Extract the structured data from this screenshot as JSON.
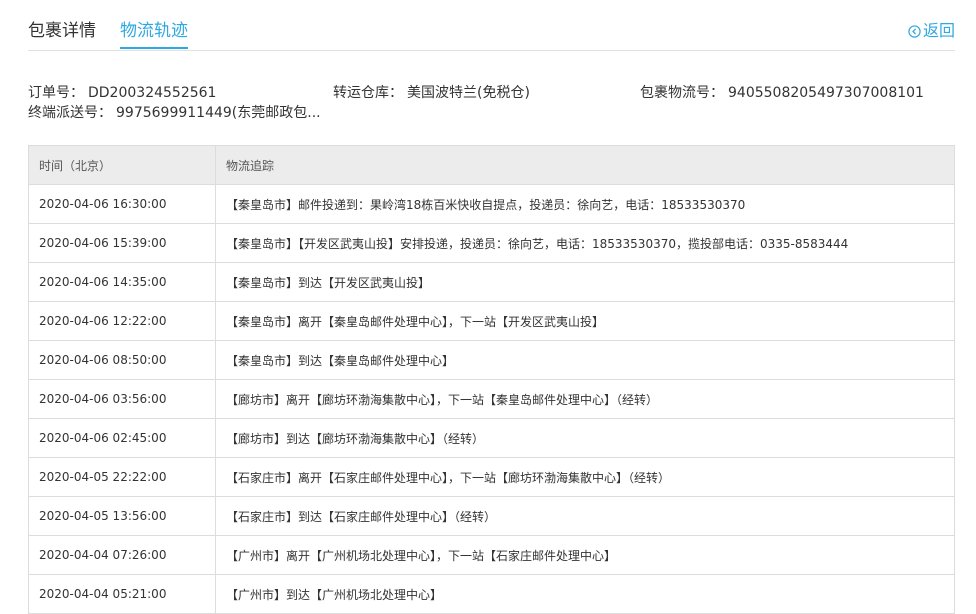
{
  "tabs": {
    "detail": "包裹详情",
    "track": "物流轨迹"
  },
  "back_label": "返回",
  "info": {
    "order_label": "订单号：",
    "order_value": "DD200324552561",
    "warehouse_label": "转运仓库：",
    "warehouse_value": "美国波特兰(免税仓)",
    "tracking_label": "包裹物流号：",
    "tracking_value": "9405508205497307008101",
    "last_mile_label": "终端派送号：",
    "last_mile_value": "9975699911449(东莞邮政包..."
  },
  "table": {
    "headers": [
      "时间（北京）",
      "物流追踪"
    ],
    "rows": [
      {
        "time": "2020-04-06 16:30:00",
        "event": "【秦皇岛市】邮件投递到：果岭湾18栋百米快收自提点，投递员：徐向艺，电话：18533530370"
      },
      {
        "time": "2020-04-06 15:39:00",
        "event": "【秦皇岛市】【开发区武夷山投】安排投递，投递员：徐向艺，电话：18533530370，揽投部电话：0335-8583444"
      },
      {
        "time": "2020-04-06 14:35:00",
        "event": "【秦皇岛市】到达【开发区武夷山投】"
      },
      {
        "time": "2020-04-06 12:22:00",
        "event": "【秦皇岛市】离开【秦皇岛邮件处理中心】，下一站【开发区武夷山投】"
      },
      {
        "time": "2020-04-06 08:50:00",
        "event": "【秦皇岛市】到达【秦皇岛邮件处理中心】"
      },
      {
        "time": "2020-04-06 03:56:00",
        "event": "【廊坊市】离开【廊坊环渤海集散中心】，下一站【秦皇岛邮件处理中心】（经转）"
      },
      {
        "time": "2020-04-06 02:45:00",
        "event": "【廊坊市】到达【廊坊环渤海集散中心】（经转）"
      },
      {
        "time": "2020-04-05 22:22:00",
        "event": "【石家庄市】离开【石家庄邮件处理中心】，下一站【廊坊环渤海集散中心】（经转）"
      },
      {
        "time": "2020-04-05 13:56:00",
        "event": "【石家庄市】到达【石家庄邮件处理中心】（经转）"
      },
      {
        "time": "2020-04-04 07:26:00",
        "event": "【广州市】离开【广州机场北处理中心】，下一站【石家庄邮件处理中心】"
      },
      {
        "time": "2020-04-04 05:21:00",
        "event": "【广州市】到达【广州机场北处理中心】"
      }
    ]
  },
  "colors": {
    "accent": "#2fa8e1",
    "header_bg": "#ececec",
    "border": "#dcdcdc"
  },
  "icons": {
    "back": "circle-left-arrow-icon"
  }
}
